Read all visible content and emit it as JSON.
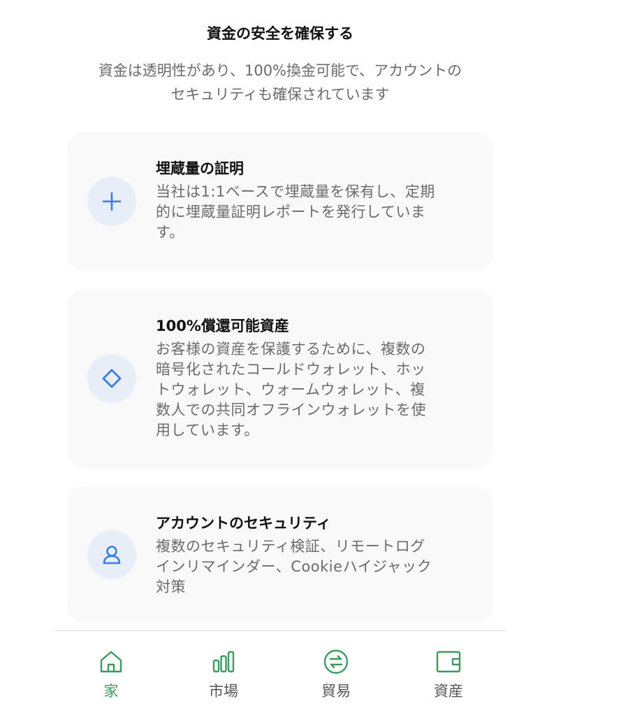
{
  "header": {
    "title": "資金の安全を確保する",
    "subtitle_line1": "資金は透明性があり、100%換金可能で、アカウントの",
    "subtitle_line2": "セキュリティも確保されています"
  },
  "cards": [
    {
      "icon": "plus-icon",
      "title": "埋蔵量の証明",
      "desc_lines": [
        "当社は1:1ベースで埋蔵量を保有し、定期",
        "的に埋蔵量証明レポートを発行していま",
        "す。"
      ]
    },
    {
      "icon": "diamond-icon",
      "title": "100%償還可能資産",
      "desc_lines": [
        "お客様の資産を保護するために、複数の",
        "暗号化されたコールドウォレット、ホッ",
        "トウォレット、ウォームウォレット、複",
        "数人での共同オフラインウォレットを使",
        "用しています。"
      ]
    },
    {
      "icon": "user-icon",
      "title": "アカウントのセキュリティ",
      "desc_lines": [
        "複数のセキュリティ検証、リモートログ",
        "インリマインダー、Cookieハイジャック",
        "対策"
      ]
    }
  ],
  "nav": {
    "items": [
      {
        "label": "家",
        "icon": "home-icon",
        "active": true
      },
      {
        "label": "市場",
        "icon": "bar-chart-icon",
        "active": false
      },
      {
        "label": "貿易",
        "icon": "exchange-icon",
        "active": false
      },
      {
        "label": "資産",
        "icon": "wallet-icon",
        "active": false
      }
    ]
  },
  "colors": {
    "accent_blue": "#3b7ddd",
    "icon_bg": "#e8eef8",
    "card_bg": "#f9f9f9",
    "nav_active": "#3c9a5f",
    "nav_inactive": "#555555"
  }
}
